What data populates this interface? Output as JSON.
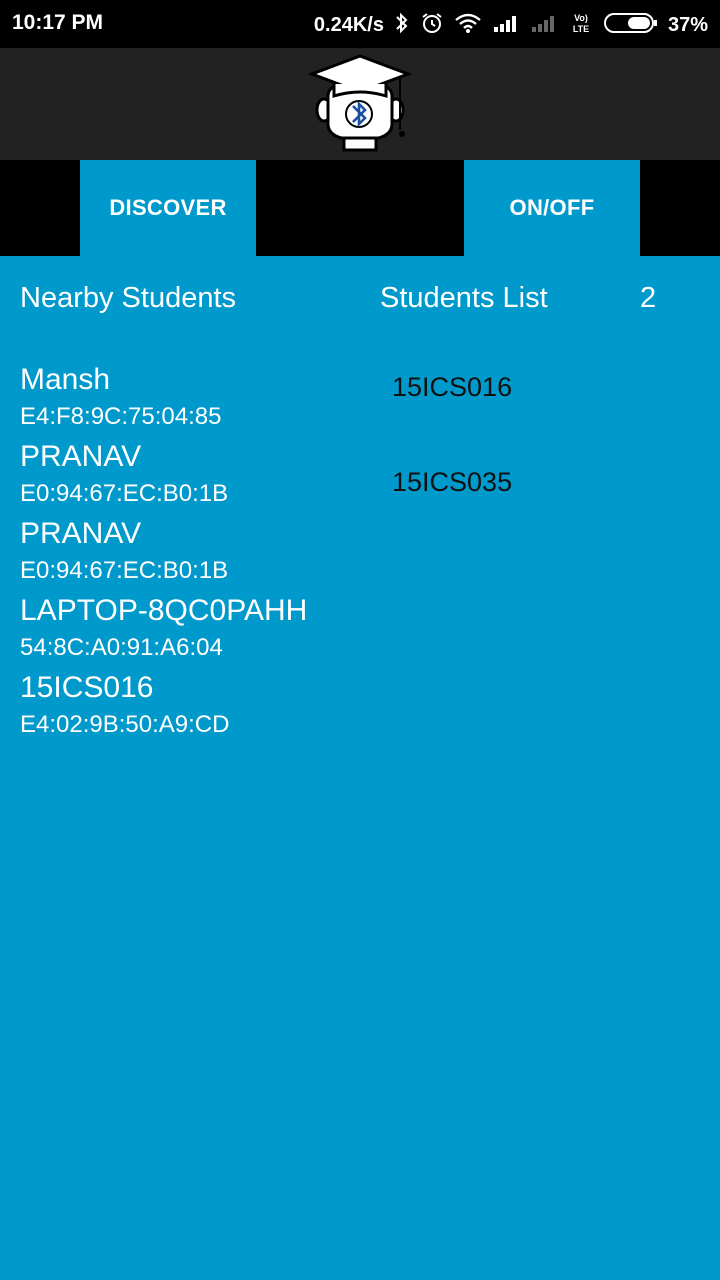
{
  "status_bar": {
    "time": "10:17 PM",
    "net_speed": "0.24K/s",
    "battery": "37%",
    "icons": [
      "bluetooth-icon",
      "alarm-icon",
      "wifi-icon",
      "signal-icon",
      "signal-empty-icon",
      "volte-icon",
      "battery-icon"
    ]
  },
  "app_bar": {
    "logo_icon": "student-bluetooth-logo-icon"
  },
  "buttons": {
    "discover": "DISCOVER",
    "onoff": "ON/OFF"
  },
  "headers": {
    "nearby": "Nearby Students",
    "students_list": "Students List",
    "count": "2"
  },
  "devices": [
    {
      "name": "Mansh",
      "mac": "E4:F8:9C:75:04:85"
    },
    {
      "name": "PRANAV",
      "mac": "E0:94:67:EC:B0:1B"
    },
    {
      "name": "PRANAV",
      "mac": "E0:94:67:EC:B0:1B"
    },
    {
      "name": "LAPTOP-8QC0PAHH",
      "mac": "54:8C:A0:91:A6:04"
    },
    {
      "name": "15ICS016",
      "mac": "E4:02:9B:50:A9:CD"
    }
  ],
  "students": [
    "15ICS016",
    "15ICS035"
  ],
  "colors": {
    "primary": "#0099cc",
    "appbar": "#222222",
    "statusbar": "#000000"
  }
}
